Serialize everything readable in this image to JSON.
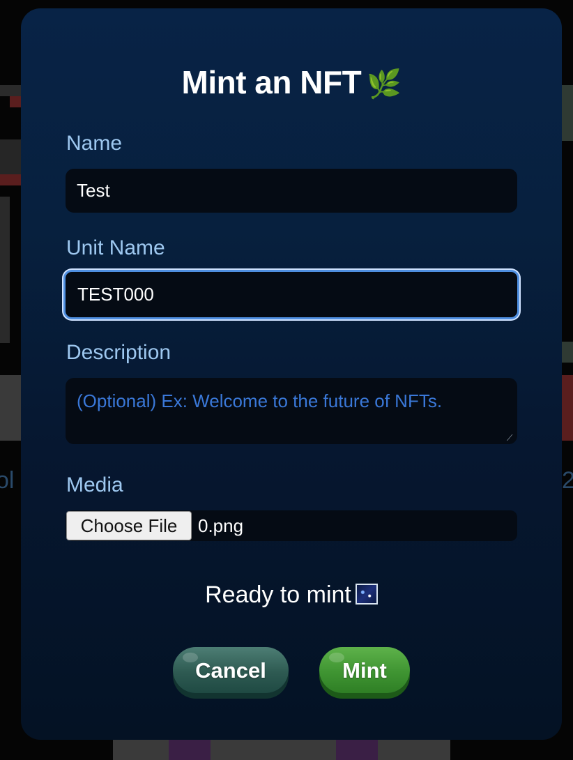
{
  "modal": {
    "title": "Mint an NFT",
    "title_icon": "leaf-icon"
  },
  "form": {
    "name_label": "Name",
    "name_value": "Test",
    "unit_name_label": "Unit Name",
    "unit_name_value": "TEST000",
    "description_label": "Description",
    "description_placeholder": "(Optional) Ex: Welcome to the future of NFTs.",
    "media_label": "Media",
    "choose_file_label": "Choose File",
    "file_name": "0.png"
  },
  "status": {
    "text": "Ready to mint",
    "icon": "image-icon"
  },
  "actions": {
    "cancel_label": "Cancel",
    "mint_label": "Mint"
  },
  "background": {
    "left_fragment": "ol",
    "right_fragment": "2"
  },
  "colors": {
    "modal_top": "#082346",
    "modal_bottom": "#041224",
    "label": "#9ec8f0",
    "input_bg": "#050b14",
    "focus_ring": "#4f8fe0",
    "placeholder": "#3a78d8",
    "cancel": "#2e5a52",
    "mint": "#3f9432"
  }
}
